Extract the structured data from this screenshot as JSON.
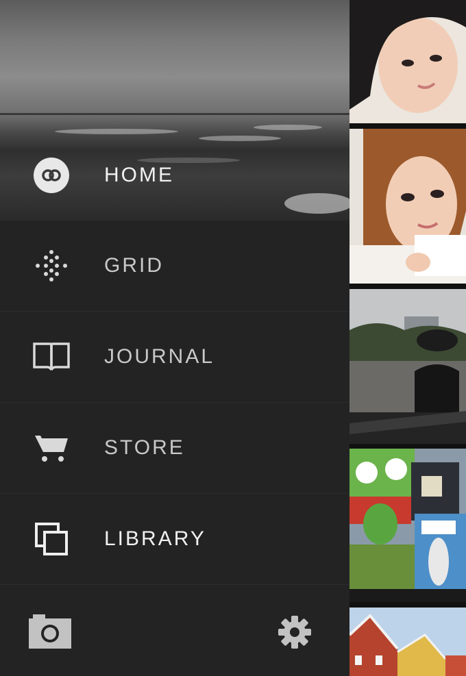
{
  "menu": {
    "items": [
      {
        "label": "HOME",
        "icon": "vsco-logo-icon",
        "active": true
      },
      {
        "label": "GRID",
        "icon": "grid-dots-icon",
        "active": false
      },
      {
        "label": "JOURNAL",
        "icon": "open-book-icon",
        "active": false
      },
      {
        "label": "STORE",
        "icon": "shopping-cart-icon",
        "active": false
      },
      {
        "label": "LIBRARY",
        "icon": "stacked-squares-icon",
        "active": false
      }
    ]
  },
  "bottom_bar": {
    "left_icon": "camera-icon",
    "right_icon": "gear-icon"
  },
  "colors": {
    "drawer_bg": "#232323",
    "label_text": "#c9c9c9",
    "icon_fill": "#e0e0e0"
  },
  "thumbnails": [
    "portrait-photo",
    "portrait-photo",
    "park-photo",
    "city-signs-photo",
    "buildings-photo"
  ]
}
